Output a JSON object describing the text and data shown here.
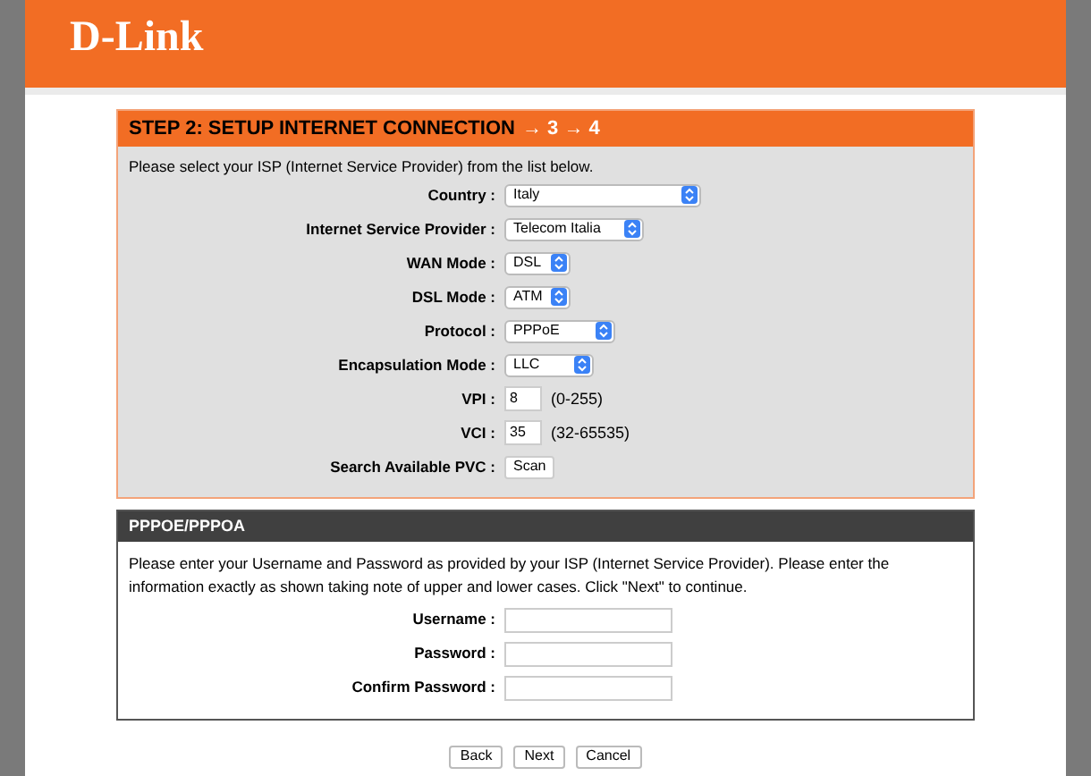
{
  "header": {
    "logo": "D-Link"
  },
  "step": {
    "title": "STEP 2: SETUP INTERNET CONNECTION",
    "upcoming": "→ 3 → 4"
  },
  "isp_section": {
    "intro": "Please select your ISP (Internet Service Provider) from the list below.",
    "fields": [
      {
        "label": "Country :",
        "kind": "select",
        "value": "Italy"
      },
      {
        "label": "Internet Service Provider :",
        "kind": "select",
        "value": "Telecom Italia"
      },
      {
        "label": "WAN Mode :",
        "kind": "select",
        "value": "DSL"
      },
      {
        "label": "DSL Mode :",
        "kind": "select",
        "value": "ATM"
      },
      {
        "label": "Protocol :",
        "kind": "select",
        "value": "PPPoE"
      },
      {
        "label": "Encapsulation Mode :",
        "kind": "select",
        "value": "LLC"
      },
      {
        "label": "VPI :",
        "kind": "number",
        "value": "8",
        "hint": "(0-255)"
      },
      {
        "label": "VCI :",
        "kind": "number",
        "value": "35",
        "hint": "(32-65535)"
      },
      {
        "label": "Search Available PVC :",
        "kind": "button",
        "value": "Scan"
      }
    ]
  },
  "pppoe_section": {
    "title": "PPPOE/PPPOA",
    "intro": "Please enter your Username and Password as provided by your ISP (Internet Service Provider). Please enter the information exactly as shown taking note of upper and lower cases. Click \"Next\" to continue.",
    "fields": [
      {
        "label": "Username :"
      },
      {
        "label": "Password :"
      },
      {
        "label": "Confirm Password :"
      }
    ]
  },
  "buttons": [
    "Back",
    "Next",
    "Cancel"
  ]
}
